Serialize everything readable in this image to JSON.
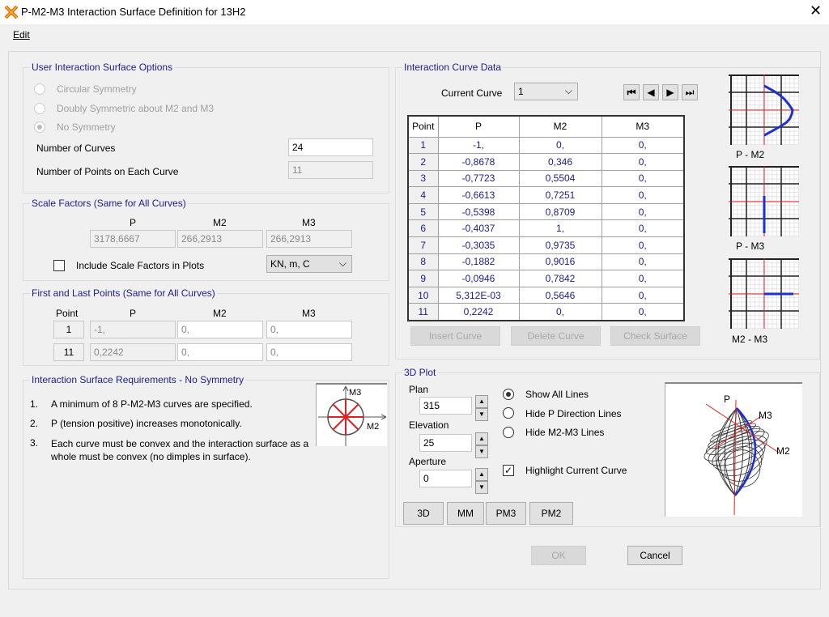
{
  "window": {
    "title": "P-M2-M3 Interaction Surface Definition for 13H2",
    "close_icon": "close-icon",
    "app_icon": "app-icon"
  },
  "menu": {
    "edit": "Edit"
  },
  "options": {
    "title": "User Interaction Surface Options",
    "radios": [
      "Circular Symmetry",
      "Doubly Symmetric about M2 and M3",
      "No Symmetry"
    ],
    "selected": 2,
    "num_curves_label": "Number of Curves",
    "num_curves": "24",
    "num_points_label": "Number of Points on Each Curve",
    "num_points": "11"
  },
  "scale": {
    "title": "Scale Factors (Same for All Curves)",
    "headers": [
      "P",
      "M2",
      "M3"
    ],
    "values": [
      "3178,6667",
      "266,2913",
      "266,2913"
    ],
    "include_label": "Include Scale Factors in Plots",
    "include_checked": false,
    "units": "KN, m, C"
  },
  "firstlast": {
    "title": "First and Last Points (Same for All Curves)",
    "headers": [
      "Point",
      "P",
      "M2",
      "M3"
    ],
    "rows": [
      [
        "1",
        "-1,",
        "0,",
        "0,"
      ],
      [
        "11",
        "0,2242",
        "0,",
        "0,"
      ]
    ]
  },
  "requirements": {
    "title": "Interaction Surface Requirements - No Symmetry",
    "items": [
      {
        "n": "1.",
        "t": "A minimum of 8 P-M2-M3 curves are specified."
      },
      {
        "n": "2.",
        "t": "P (tension positive) increases monotonically."
      },
      {
        "n": "3.",
        "t": "Each curve must be convex and the interaction surface as a whole must be convex (no dimples in surface)."
      }
    ],
    "diagram_m3": "M3",
    "diagram_m2": "M2"
  },
  "curve": {
    "title": "Interaction Curve Data",
    "current_label": "Current Curve",
    "current": "1",
    "headers": [
      "Point",
      "P",
      "M2",
      "M3"
    ],
    "rows": [
      [
        "1",
        "-1,",
        "0,",
        "0,"
      ],
      [
        "2",
        "-0,8678",
        "0,346",
        "0,"
      ],
      [
        "3",
        "-0,7723",
        "0,5504",
        "0,"
      ],
      [
        "4",
        "-0,6613",
        "0,7251",
        "0,"
      ],
      [
        "5",
        "-0,5398",
        "0,8709",
        "0,"
      ],
      [
        "6",
        "-0,4037",
        "1,",
        "0,"
      ],
      [
        "7",
        "-0,3035",
        "0,9735",
        "0,"
      ],
      [
        "8",
        "-0,1882",
        "0,9016",
        "0,"
      ],
      [
        "9",
        "-0,0946",
        "0,7842",
        "0,"
      ],
      [
        "10",
        "5,312E-03",
        "0,5646",
        "0,"
      ],
      [
        "11",
        "0,2242",
        "0,",
        "0,"
      ]
    ],
    "insert": "Insert Curve",
    "delete": "Delete Curve",
    "check": "Check Surface",
    "plots": [
      "P - M2",
      "P - M3",
      "M2 - M3"
    ]
  },
  "plot3d": {
    "title": "3D Plot",
    "plan_label": "Plan",
    "plan": "315",
    "elev_label": "Elevation",
    "elev": "25",
    "aperture_label": "Aperture",
    "aperture": "0",
    "line_options": [
      "Show All Lines",
      "Hide P Direction Lines",
      "Hide M2-M3 Lines"
    ],
    "line_selected": 0,
    "highlight_label": "Highlight Current Curve",
    "highlight_checked": true,
    "views": [
      "3D",
      "MM",
      "PM3",
      "PM2"
    ],
    "axis_p": "P",
    "axis_m3": "M3",
    "axis_m2": "M2"
  },
  "buttons": {
    "ok": "OK",
    "cancel": "Cancel"
  },
  "colors": {
    "accent": "#1c1c8c",
    "curve": "#2030d0",
    "axis": "#e02020"
  }
}
